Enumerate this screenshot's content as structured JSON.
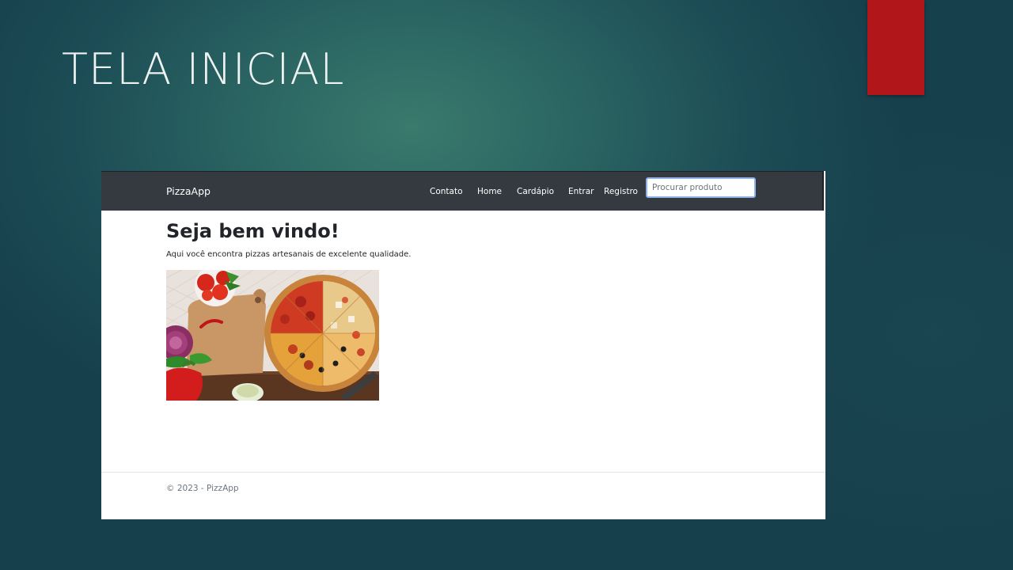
{
  "slide": {
    "title": "TELA INICIAL",
    "accent_color": "#b0161a"
  },
  "app": {
    "navbar": {
      "background": "#343a40",
      "brand": "PizzaApp",
      "links": [
        {
          "label": "Contato"
        },
        {
          "label": "Home"
        },
        {
          "label": "Cardápio"
        },
        {
          "label": "Entrar"
        },
        {
          "label": "Registro"
        }
      ],
      "search": {
        "placeholder": "Procurar produto",
        "value": ""
      }
    },
    "main": {
      "heading": "Seja bem vindo!",
      "subtitle": "Aqui você encontra pizzas artesanais de excelente qualidade.",
      "image_icon": "pizza-photo"
    },
    "footer": {
      "text": "© 2023 - PizzApp"
    }
  }
}
